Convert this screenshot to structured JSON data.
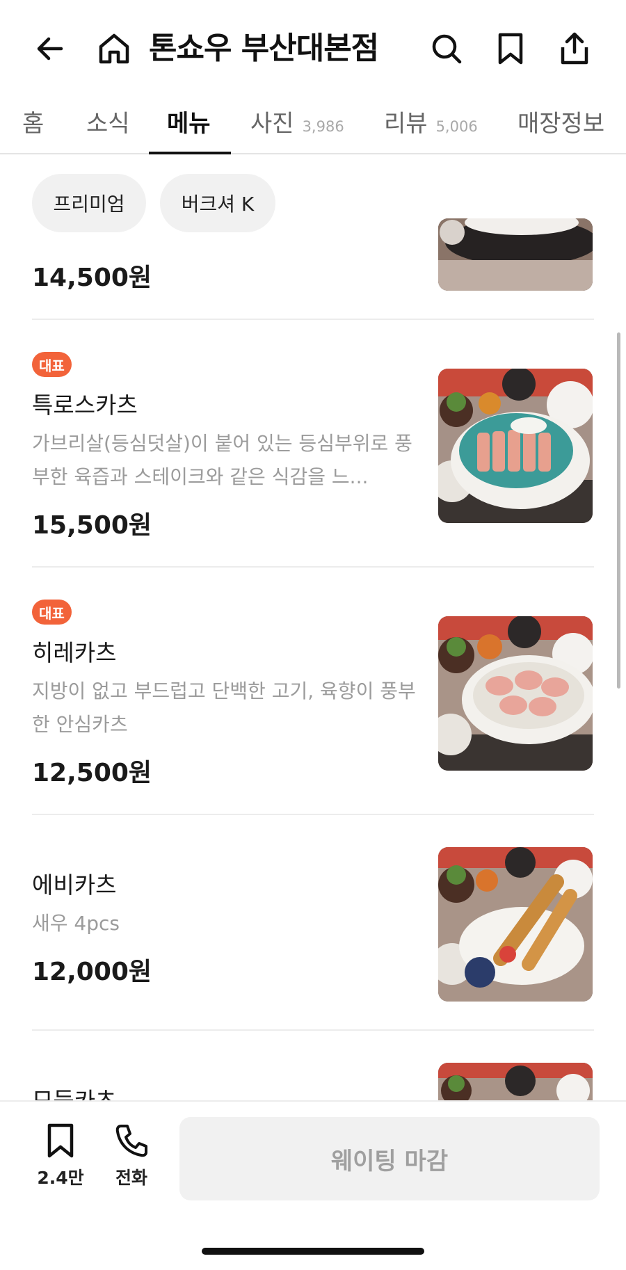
{
  "header": {
    "title": "톤쇼우 부산대본점",
    "icons": [
      "back-arrow-icon",
      "home-icon",
      "search-icon",
      "bookmark-icon",
      "share-icon"
    ]
  },
  "tabs": [
    {
      "label": "홈",
      "count": ""
    },
    {
      "label": "소식",
      "count": ""
    },
    {
      "label": "메뉴",
      "count": ""
    },
    {
      "label": "사진",
      "count": "3,986"
    },
    {
      "label": "리뷰",
      "count": "5,006"
    },
    {
      "label": "매장정보",
      "count": ""
    }
  ],
  "active_tab": "메뉴",
  "filters": [
    "프리미엄",
    "버크셔 K"
  ],
  "menu": [
    {
      "name": "",
      "badge": "",
      "description": "",
      "price": "14,500원"
    },
    {
      "name": "특로스카츠",
      "badge": "대표",
      "description": "가브리살(등심덧살)이 붙어 있는 등심부위로 풍부한 육즙과 스테이크와 같은 식감을 느...",
      "price": "15,500원"
    },
    {
      "name": "히레카츠",
      "badge": "대표",
      "description": "지방이 없고 부드럽고 단백한 고기, 육향이 풍부한 안심카츠",
      "price": "12,500원"
    },
    {
      "name": "에비카츠",
      "badge": "",
      "description": "새우 4pcs",
      "price": "12,000원"
    },
    {
      "name": "모듬카츠",
      "badge": "",
      "description": "",
      "price": ""
    }
  ],
  "bottom_bar": {
    "bookmark_count": "2.4만",
    "phone_label": "전화",
    "waiting_label": "웨이팅 마감"
  },
  "colors": {
    "badge": "#f2633a",
    "text_primary": "#1a1a1a",
    "text_secondary": "#9b9b9b",
    "disabled_button": "#f1f1f1"
  }
}
